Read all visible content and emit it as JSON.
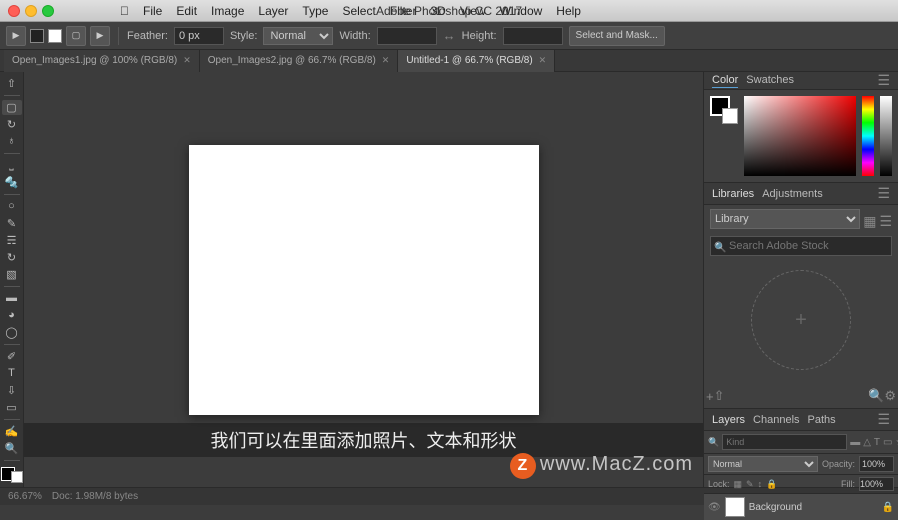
{
  "titleBar": {
    "appName": "Adobe Photoshop CC 2017",
    "menus": [
      "",
      "File",
      "Edit",
      "Image",
      "Layer",
      "Type",
      "Select",
      "Filter",
      "3D",
      "View",
      "Window",
      "Help"
    ]
  },
  "toolbar": {
    "featherLabel": "Feather:",
    "featherValue": "0 px",
    "styleLabel": "Style:",
    "styleValue": "Normal",
    "widthLabel": "Width:",
    "heightLabel": "Height:",
    "selectAndMaskBtn": "Select and Mask..."
  },
  "tabs": [
    {
      "label": "Open_Images1.jpg @ 100% (RGB/8)",
      "active": false
    },
    {
      "label": "Open_Images2.jpg @ 66.7% (RGB/8)",
      "active": false
    },
    {
      "label": "Untitled-1 @ 66.7% (RGB/8)",
      "active": true
    }
  ],
  "panels": {
    "color": {
      "tabs": [
        "Color",
        "Swatches"
      ],
      "activeTab": "Color"
    },
    "libraries": {
      "tabs": [
        "Libraries",
        "Adjustments"
      ],
      "activeTab": "Libraries",
      "selectValue": "Library",
      "searchPlaceholder": "Search Adobe Stock",
      "addIcon": "+",
      "uploadIcon": "↑"
    },
    "layers": {
      "tabs": [
        "Layers",
        "Channels",
        "Paths"
      ],
      "activeTab": "Layers",
      "kindPlaceholder": "Kind",
      "blendMode": "Normal",
      "opacityLabel": "Opacity:",
      "opacityValue": "100%",
      "lockLabel": "Lock:",
      "fillLabel": "Fill:",
      "fillValue": "100%",
      "layers": [
        {
          "name": "Background",
          "visible": true,
          "locked": true
        }
      ]
    }
  },
  "statusBar": {
    "zoom": "66.67%",
    "docSize": "Doc: 1.98M/8 bytes"
  },
  "subtitle": "我们可以在里面添加照片、文本和形状",
  "watermark": "www.MacZ.com"
}
